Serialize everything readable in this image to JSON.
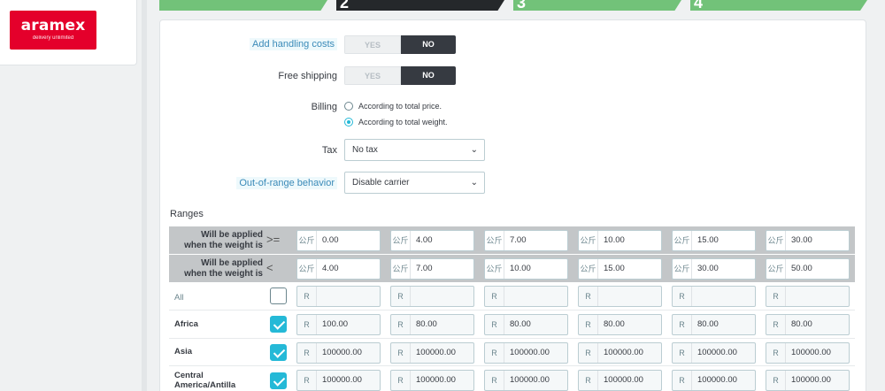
{
  "brand": {
    "name": "aramex",
    "tagline": "delivery unlimited"
  },
  "steps": [
    {
      "num": "",
      "active": false
    },
    {
      "num": "2",
      "active": true
    },
    {
      "num": "3",
      "active": false
    },
    {
      "num": "4",
      "active": false
    }
  ],
  "form": {
    "handling": {
      "label": "Add handling costs",
      "yes": "YES",
      "no": "NO",
      "value": "NO"
    },
    "free_shipping": {
      "label": "Free shipping",
      "yes": "YES",
      "no": "NO",
      "value": "NO"
    },
    "billing": {
      "label": "Billing",
      "options": [
        "According to total price.",
        "According to total weight."
      ],
      "selected": "According to total weight."
    },
    "tax": {
      "label": "Tax",
      "value": "No tax"
    },
    "out_of_range": {
      "label": "Out-of-range behavior",
      "value": "Disable carrier"
    }
  },
  "ranges": {
    "title": "Ranges",
    "unit": "公斤",
    "currency": "R",
    "from_row": {
      "label_line1": "Will be applied",
      "label_line2": "when the weight is",
      "operator": ">=",
      "values": [
        "0.00",
        "4.00",
        "7.00",
        "10.00",
        "15.00",
        "30.00"
      ]
    },
    "to_row": {
      "label_line1": "Will be applied",
      "label_line2": "when the weight is",
      "operator": "<",
      "values": [
        "4.00",
        "7.00",
        "10.00",
        "15.00",
        "30.00",
        "50.00"
      ]
    },
    "zones": [
      {
        "name": "All",
        "checked": false,
        "prices": [
          "",
          "",
          "",
          "",
          "",
          ""
        ]
      },
      {
        "name": "Africa",
        "checked": true,
        "prices": [
          "100.00",
          "80.00",
          "80.00",
          "80.00",
          "80.00",
          "80.00"
        ]
      },
      {
        "name": "Asia",
        "checked": true,
        "prices": [
          "100000.00",
          "100000.00",
          "100000.00",
          "100000.00",
          "100000.00",
          "100000.00"
        ]
      },
      {
        "name_line1": "Central",
        "name_line2": "America/Antilla",
        "checked": true,
        "prices": [
          "100000.00",
          "100000.00",
          "100000.00",
          "100000.00",
          "100000.00",
          "100000.00"
        ]
      }
    ]
  }
}
